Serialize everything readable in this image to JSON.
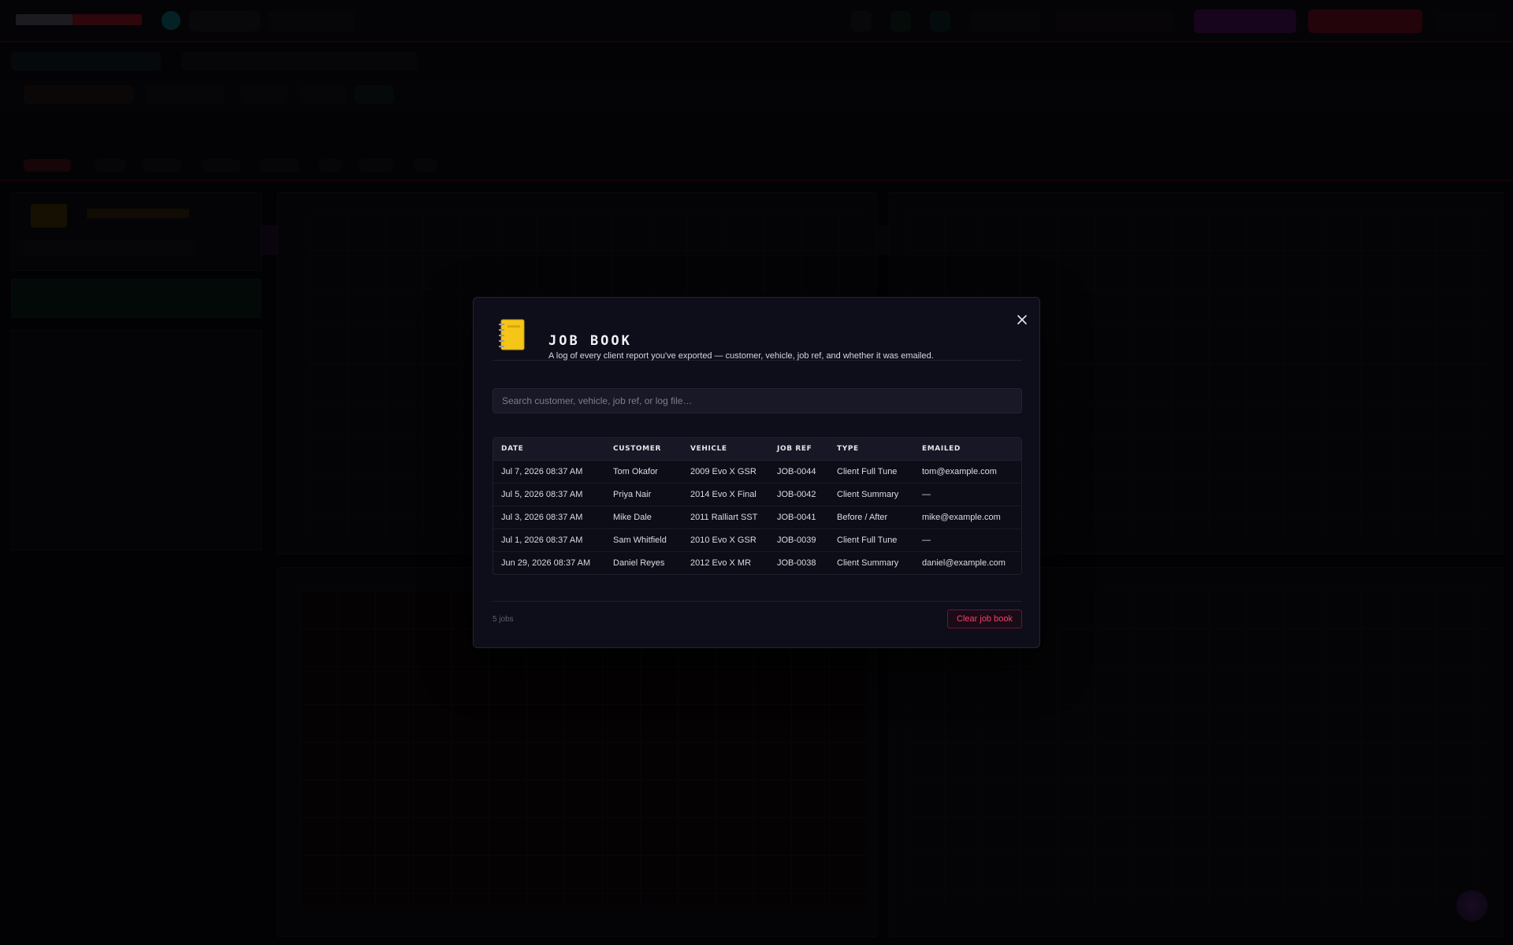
{
  "modal": {
    "title": "JOB BOOK",
    "subtitle": "A log of every client report you've exported — customer, vehicle, job ref, and whether it was emailed.",
    "close_icon": "close-icon",
    "notebook_icon": "notebook-icon",
    "search": {
      "placeholder": "Search customer, vehicle, job ref, or log file…",
      "value": ""
    },
    "table": {
      "columns": [
        "DATE",
        "CUSTOMER",
        "VEHICLE",
        "JOB REF",
        "TYPE",
        "EMAILED"
      ],
      "rows": [
        [
          "Jul 7, 2026 08:37 AM",
          "Tom Okafor",
          "2009 Evo X GSR",
          "JOB-0044",
          "Client Full Tune",
          "tom@example.com"
        ],
        [
          "Jul 5, 2026 08:37 AM",
          "Priya Nair",
          "2014 Evo X Final",
          "JOB-0042",
          "Client Summary",
          "—"
        ],
        [
          "Jul 3, 2026 08:37 AM",
          "Mike Dale",
          "2011 Ralliart SST",
          "JOB-0041",
          "Before / After",
          "mike@example.com"
        ],
        [
          "Jul 1, 2026 08:37 AM",
          "Sam Whitfield",
          "2010 Evo X GSR",
          "JOB-0039",
          "Client Full Tune",
          "—"
        ],
        [
          "Jun 29, 2026 08:37 AM",
          "Daniel Reyes",
          "2012 Evo X MR",
          "JOB-0038",
          "Client Summary",
          "daniel@example.com"
        ]
      ]
    },
    "footer": {
      "count": "5 jobs",
      "clear_label": "Clear job book"
    }
  },
  "colors": {
    "accent_danger": "#ff3d6a",
    "notebook_yellow": "#f5c518",
    "modal_bg": "#0e0e1a"
  }
}
